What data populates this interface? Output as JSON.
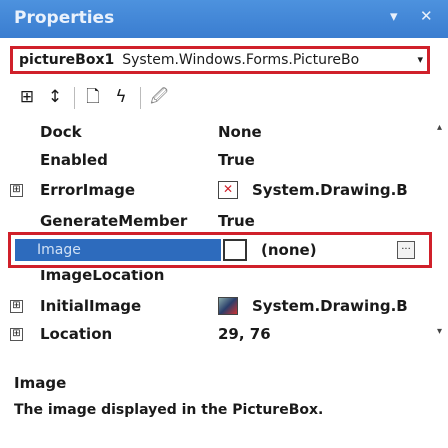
{
  "window": {
    "title": "Properties",
    "pin_glyph": "▾",
    "close_glyph": "✕"
  },
  "object_selector": {
    "name": "pictureBox1",
    "type": "System.Windows.Forms.PictureBo"
  },
  "toolbar": [
    {
      "name": "categorized-icon",
      "glyph": "⊞"
    },
    {
      "name": "alphabetical-icon",
      "glyph": "↕"
    },
    {
      "name": "properties-icon",
      "glyph": "🗋"
    },
    {
      "name": "events-icon",
      "glyph": "ϟ"
    },
    {
      "name": "property-pages-icon",
      "glyph": "🖉"
    }
  ],
  "properties": [
    {
      "name": "Dock",
      "value": "None"
    },
    {
      "name": "Enabled",
      "value": "True"
    },
    {
      "name": "ErrorImage",
      "value": "System.Drawing.B"
    },
    {
      "name": "GenerateMember",
      "value": "True"
    },
    {
      "name": "Image",
      "value": "(none)"
    },
    {
      "name": "ImageLocation",
      "value": ""
    },
    {
      "name": "InitialImage",
      "value": "System.Drawing.B"
    },
    {
      "name": "Location",
      "value": "29, 76"
    }
  ],
  "expand_glyph": "⊞",
  "ellipsis": "...",
  "description": {
    "title": "Image",
    "text": "The image displayed in the PictureBox."
  }
}
